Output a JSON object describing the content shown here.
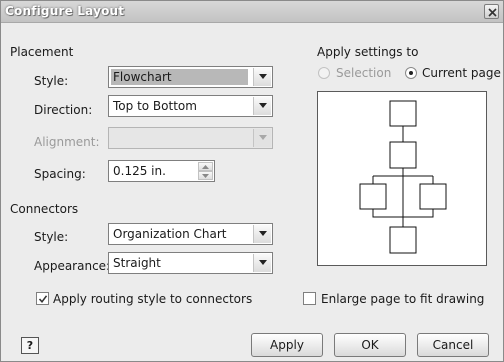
{
  "window": {
    "title": "Configure Layout",
    "close_icon": "close-icon"
  },
  "placement": {
    "heading": "Placement",
    "style": {
      "label": "Style:",
      "value": "Flowchart",
      "selected": true
    },
    "direction": {
      "label": "Direction:",
      "value": "Top to Bottom"
    },
    "alignment": {
      "label": "Alignment:",
      "value": "",
      "enabled": false
    },
    "spacing": {
      "label": "Spacing:",
      "value": "0.125 in."
    }
  },
  "connectors": {
    "heading": "Connectors",
    "style": {
      "label": "Style:",
      "value": "Organization Chart"
    },
    "appearance": {
      "label": "Appearance:",
      "value": "Straight"
    },
    "routing": {
      "label": "Apply routing style to connectors",
      "checked": true
    }
  },
  "apply_settings": {
    "heading": "Apply settings to",
    "options": [
      {
        "label": "Selection",
        "selected": false,
        "enabled": false
      },
      {
        "label": "Current page",
        "selected": true,
        "enabled": true
      }
    ]
  },
  "enlarge_page": {
    "label": "Enlarge page to fit drawing",
    "checked": false
  },
  "buttons": {
    "help_icon": "help-icon",
    "help_glyph": "?",
    "apply": "Apply",
    "ok": "OK",
    "cancel": "Cancel"
  }
}
